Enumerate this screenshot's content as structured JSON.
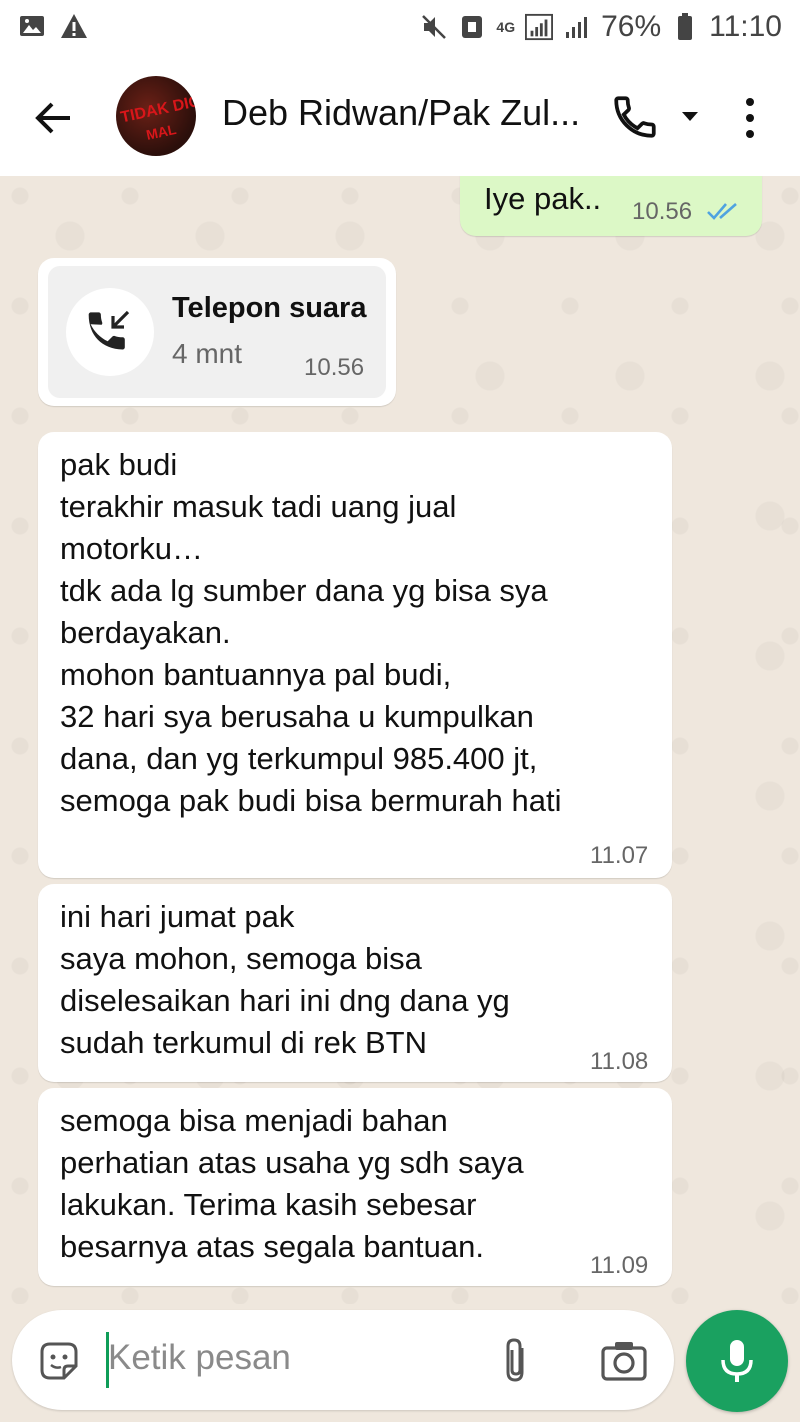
{
  "status_bar": {
    "network": "4G",
    "battery": "76%",
    "time": "11:10"
  },
  "header": {
    "contact_name": "Deb Ridwan/Pak Zul...",
    "avatar_text": [
      "TIDAK DICA",
      "MAL"
    ]
  },
  "messages": [
    {
      "id": "m1",
      "direction": "outgoing",
      "text": "Iye pak..",
      "time": "10.56",
      "status": "read"
    },
    {
      "id": "m2",
      "direction": "incoming",
      "type": "voice_call",
      "title": "Telepon suara",
      "duration": "4 mnt",
      "time": "10.56"
    },
    {
      "id": "m3",
      "direction": "incoming",
      "text": "pak  budi\nterakhir masuk tadi uang jual\nmotorku…\ntdk ada lg sumber dana yg bisa sya\nberdayakan.\nmohon bantuannya pal budi,\n32 hari sya berusaha u kumpulkan\ndana, dan yg terkumpul 985.400 jt,\nsemoga pak budi bisa bermurah hati",
      "time": "11.07"
    },
    {
      "id": "m4",
      "direction": "incoming",
      "text": "ini hari jumat pak\nsaya mohon, semoga bisa\ndiselesaikan hari ini dng dana yg\nsudah terkumul di rek BTN",
      "time": "11.08"
    },
    {
      "id": "m5",
      "direction": "incoming",
      "text": "semoga bisa menjadi bahan\nperhatian atas usaha yg sdh saya\nlakukan. Terima kasih sebesar\nbesarnya atas segala bantuan.",
      "time": "11.09"
    }
  ],
  "composer": {
    "placeholder": "Ketik pesan"
  },
  "colors": {
    "outgoing_bubble": "#dcf8c6",
    "incoming_bubble": "#ffffff",
    "accent_green": "#1aa160",
    "read_ticks": "#4fa3e0"
  }
}
